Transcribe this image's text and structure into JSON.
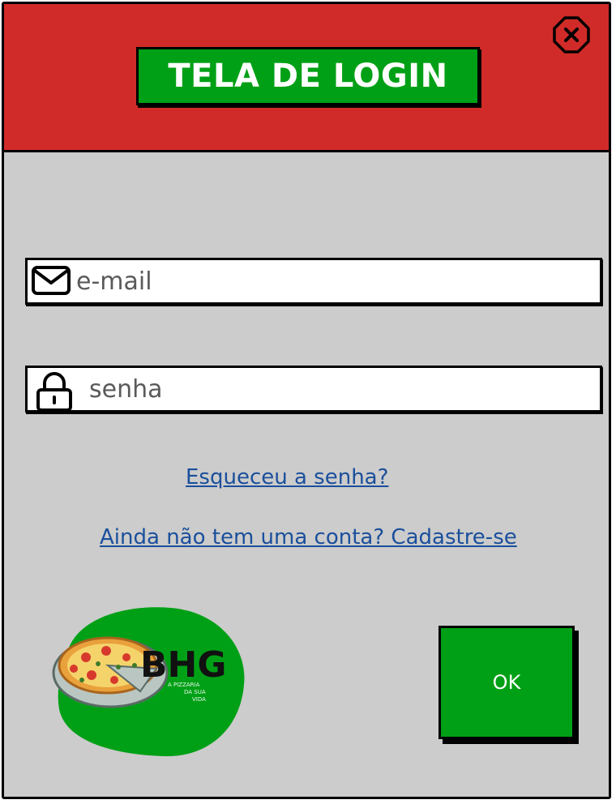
{
  "header": {
    "title": "TELA DE LOGIN",
    "close_icon": "close-circle-icon"
  },
  "form": {
    "email": {
      "icon": "envelope-icon",
      "value": "",
      "placeholder": "e-mail"
    },
    "password": {
      "icon": "padlock-icon",
      "value": "",
      "placeholder": "senha"
    }
  },
  "links": {
    "forgot_password": "Esqueceu a senha?",
    "signup": " Ainda não tem uma conta? Cadastre-se"
  },
  "logo": {
    "brand": "BHG",
    "tagline_line1": "A PIZZARIA",
    "tagline_line2": "DA SUA",
    "tagline_line3": "VIDA"
  },
  "buttons": {
    "ok_label": "OK"
  },
  "colors": {
    "header_bg": "#d02b28",
    "accent_green": "#00a016",
    "body_bg": "#cccccc",
    "link": "#1a4f9c"
  }
}
